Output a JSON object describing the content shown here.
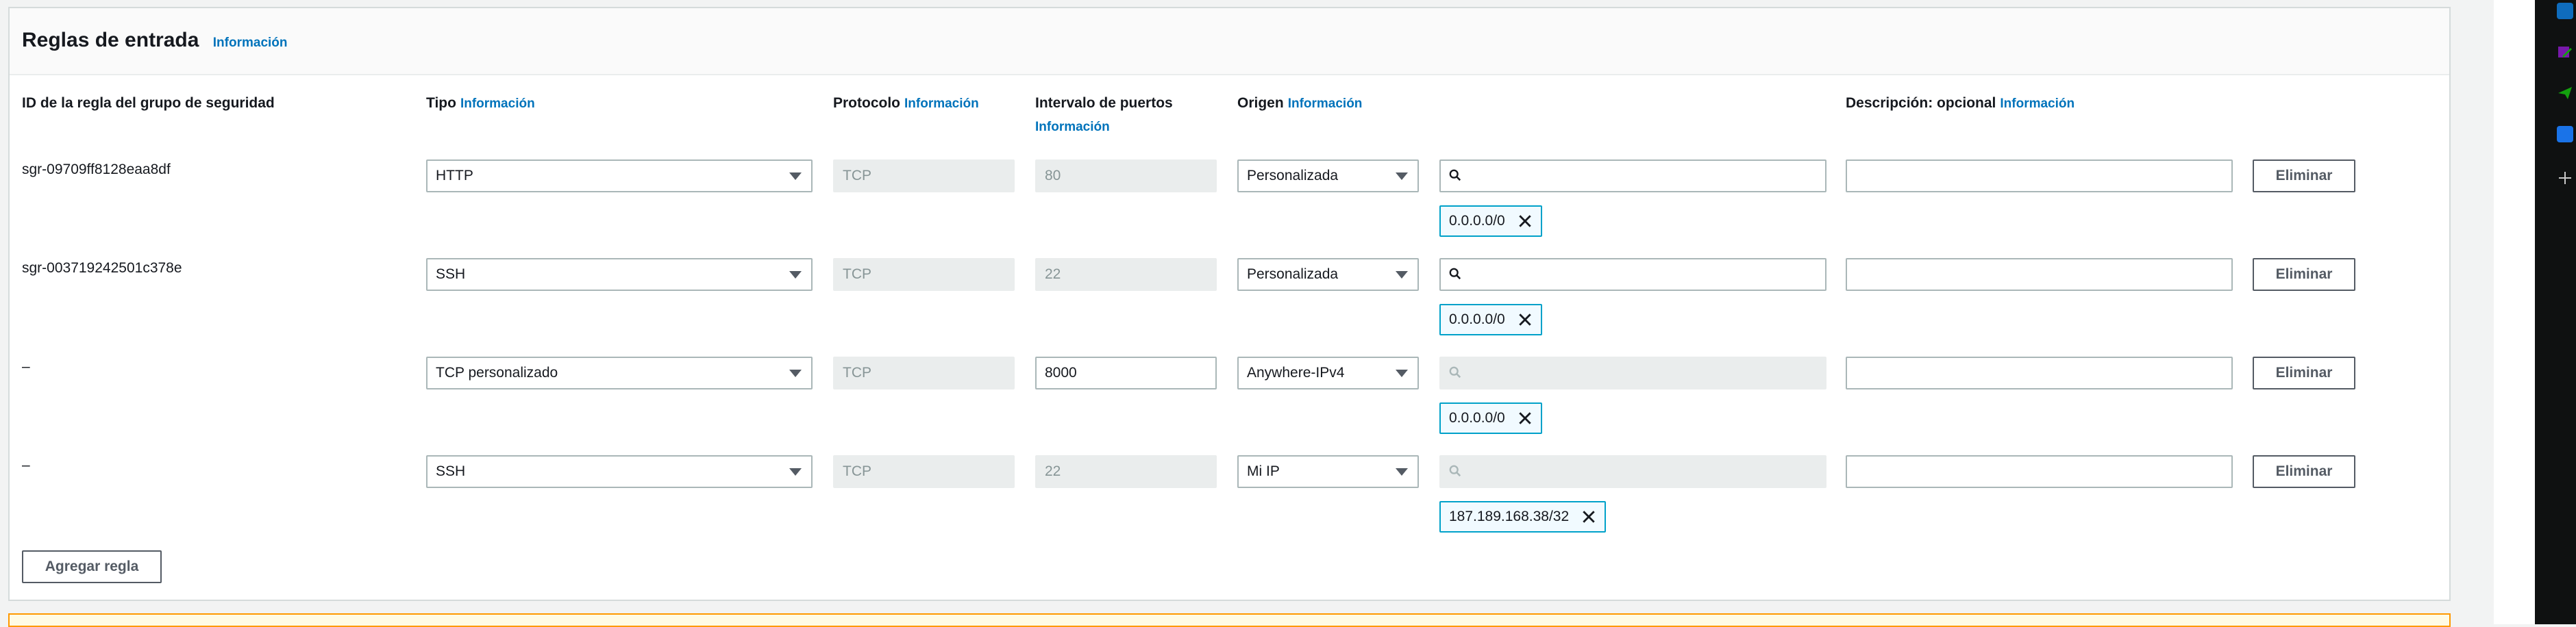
{
  "section": {
    "title": "Reglas de entrada",
    "title_info": "Información"
  },
  "columns": {
    "id": {
      "label": "ID de la regla del grupo de seguridad"
    },
    "type": {
      "label": "Tipo",
      "info": "Información"
    },
    "protocol": {
      "label": "Protocolo",
      "info": "Información"
    },
    "ports": {
      "label": "Intervalo de puertos",
      "info": "Información"
    },
    "source": {
      "label": "Origen",
      "info": "Información"
    },
    "description": {
      "label": "Descripción: opcional",
      "info": "Información"
    }
  },
  "rules": [
    {
      "id": "sgr-09709ff8128eaa8df",
      "type": "HTTP",
      "protocol": "TCP",
      "port": "80",
      "source": "Personalizada",
      "cidr": "0.0.0.0/0",
      "description": "",
      "delete_label": "Eliminar"
    },
    {
      "id": "sgr-003719242501c378e",
      "type": "SSH",
      "protocol": "TCP",
      "port": "22",
      "source": "Personalizada",
      "cidr": "0.0.0.0/0",
      "description": "",
      "delete_label": "Eliminar"
    },
    {
      "id": "–",
      "type": "TCP personalizado",
      "protocol": "TCP",
      "port": "8000",
      "source": "Anywhere-IPv4",
      "cidr": "0.0.0.0/0",
      "description": "",
      "delete_label": "Eliminar"
    },
    {
      "id": "–",
      "type": "SSH",
      "protocol": "TCP",
      "port": "22",
      "source": "Mi IP",
      "cidr": "187.189.168.38/32",
      "description": "",
      "delete_label": "Eliminar"
    }
  ],
  "add_rule_label": "Agregar regla",
  "colors": {
    "link": "#0073bb",
    "token_border": "#00a1c9",
    "disabled_bg": "#eaeded",
    "warning_border": "#ff9900"
  },
  "side_icons": [
    "outlook-icon",
    "onenote-icon",
    "send-icon",
    "translator-icon",
    "plus-icon"
  ]
}
